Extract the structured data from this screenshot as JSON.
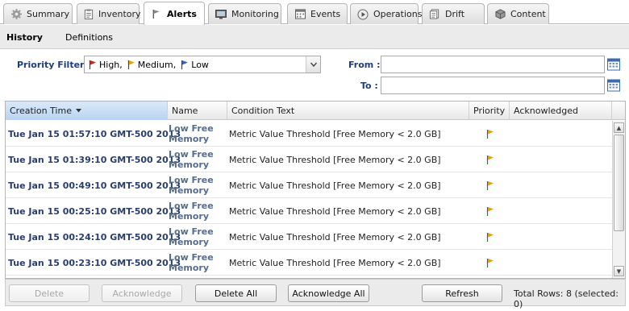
{
  "tabs": [
    {
      "label": "Summary",
      "icon": "gear-icon"
    },
    {
      "label": "Inventory",
      "icon": "clipboard-icon"
    },
    {
      "label": "Alerts",
      "icon": "flag-icon",
      "active": true
    },
    {
      "label": "Monitoring",
      "icon": "monitor-icon"
    },
    {
      "label": "Events",
      "icon": "calendar-icon"
    },
    {
      "label": "Operations",
      "icon": "play-icon"
    },
    {
      "label": "Drift",
      "icon": "document-icon"
    },
    {
      "label": "Content",
      "icon": "box-icon"
    }
  ],
  "subtabs": {
    "history": "History",
    "definitions": "Definitions"
  },
  "filters": {
    "priority_label": "Priority Filter :",
    "priority_options": [
      {
        "label": "High,",
        "color": "#cc2222"
      },
      {
        "label": "Medium,",
        "color": "#e8a100"
      },
      {
        "label": "Low",
        "color": "#3a63b5"
      }
    ],
    "from_label": "From :",
    "to_label": "To :",
    "from_value": "",
    "to_value": ""
  },
  "grid": {
    "columns": {
      "creation_time": "Creation Time",
      "name": "Name",
      "condition": "Condition Text",
      "priority": "Priority",
      "acknowledged": "Acknowledged"
    },
    "rows": [
      {
        "time": "Tue Jan 15 01:57:10 GMT-500 2013",
        "name1": "Low Free",
        "name2": "Memory",
        "condition": "Metric Value Threshold [Free Memory < 2.0 GB]",
        "priority_color": "#e8a100",
        "acknowledged": ""
      },
      {
        "time": "Tue Jan 15 01:39:10 GMT-500 2013",
        "name1": "Low Free",
        "name2": "Memory",
        "condition": "Metric Value Threshold [Free Memory < 2.0 GB]",
        "priority_color": "#e8a100",
        "acknowledged": ""
      },
      {
        "time": "Tue Jan 15 00:49:10 GMT-500 2013",
        "name1": "Low Free",
        "name2": "Memory",
        "condition": "Metric Value Threshold [Free Memory < 2.0 GB]",
        "priority_color": "#e8a100",
        "acknowledged": ""
      },
      {
        "time": "Tue Jan 15 00:25:10 GMT-500 2013",
        "name1": "Low Free",
        "name2": "Memory",
        "condition": "Metric Value Threshold [Free Memory < 2.0 GB]",
        "priority_color": "#e8a100",
        "acknowledged": ""
      },
      {
        "time": "Tue Jan 15 00:24:10 GMT-500 2013",
        "name1": "Low Free",
        "name2": "Memory",
        "condition": "Metric Value Threshold [Free Memory < 2.0 GB]",
        "priority_color": "#e8a100",
        "acknowledged": ""
      },
      {
        "time": "Tue Jan 15 00:23:10 GMT-500 2013",
        "name1": "Low Free",
        "name2": "Memory",
        "condition": "Metric Value Threshold [Free Memory < 2.0 GB]",
        "priority_color": "#e8a100",
        "acknowledged": ""
      }
    ]
  },
  "toolbar": {
    "delete": "Delete",
    "acknowledge": "Acknowledge",
    "delete_all": "Delete All",
    "acknowledge_all": "Acknowledge All",
    "refresh": "Refresh",
    "totals": "Total Rows: 8 (selected: 0)"
  }
}
